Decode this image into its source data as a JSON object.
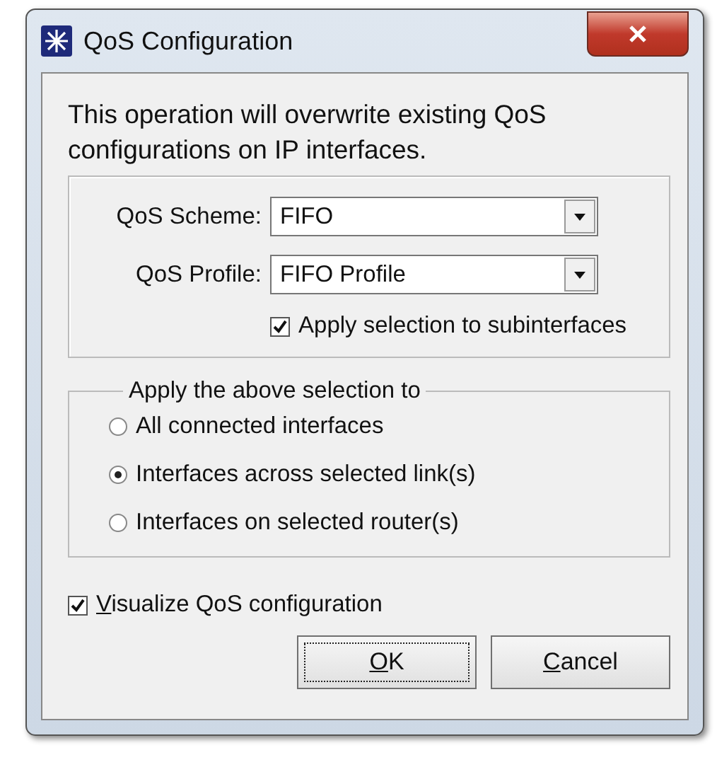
{
  "window": {
    "title": "QoS Configuration"
  },
  "message": "This operation will overwrite existing QoS configurations on IP interfaces.",
  "fields": [
    {
      "label": "QoS Scheme:",
      "value": "FIFO"
    },
    {
      "label": "QoS Profile:",
      "value": "FIFO Profile"
    }
  ],
  "subinterfaces": {
    "label": "Apply selection to subinterfaces",
    "checked": true
  },
  "apply_group": {
    "title": "Apply the above selection to",
    "options": [
      {
        "label": "All connected interfaces",
        "selected": false
      },
      {
        "label": "Interfaces across selected link(s)",
        "selected": true
      },
      {
        "label": "Interfaces on selected router(s)",
        "selected": false
      }
    ]
  },
  "visualize": {
    "label": "Visualize QoS configuration",
    "checked": true
  },
  "buttons": [
    {
      "label": "OK",
      "focused": true
    },
    {
      "label": "Cancel",
      "focused": false
    }
  ]
}
